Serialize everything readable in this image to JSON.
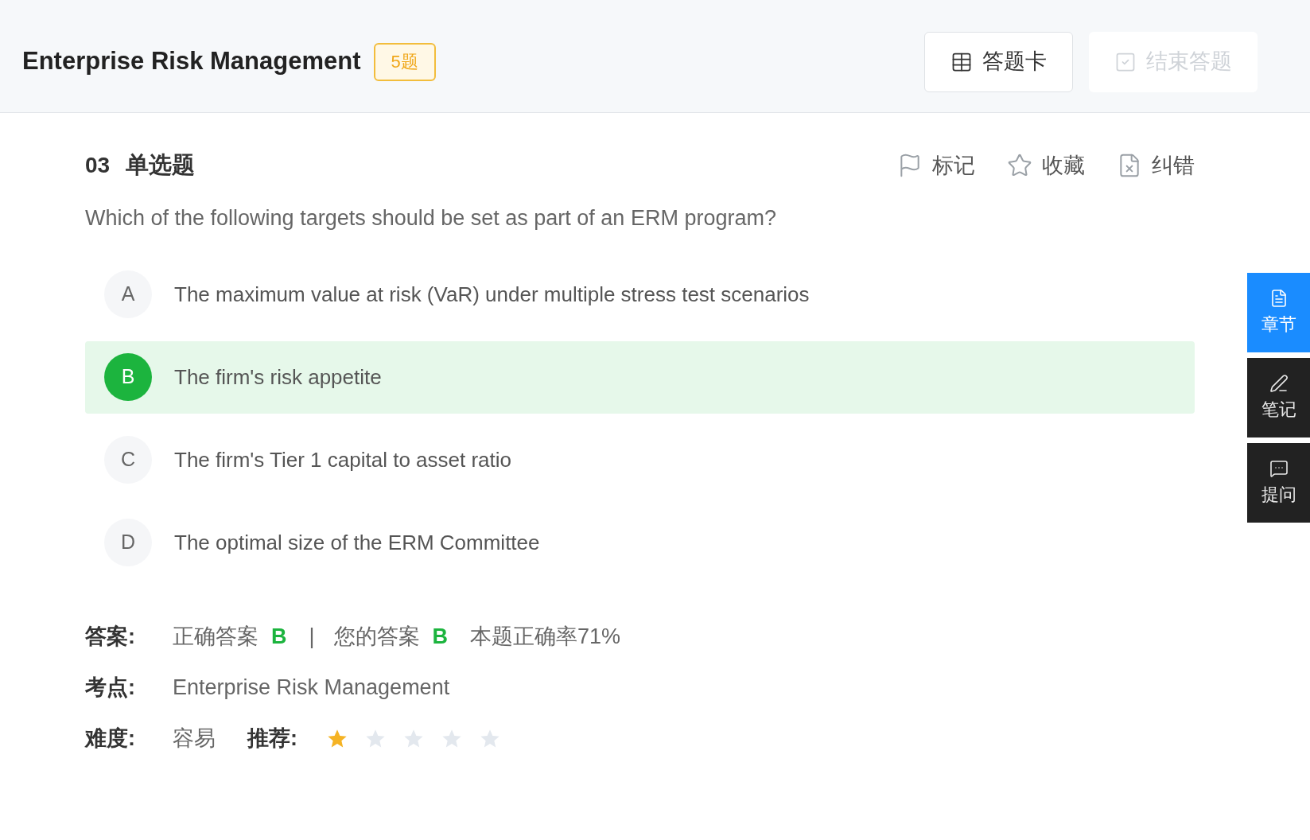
{
  "header": {
    "title": "Enterprise Risk Management",
    "count_badge": "5题",
    "buttons": [
      {
        "label": "答题卡",
        "kind": "card",
        "disabled": false
      },
      {
        "label": "结束答题",
        "kind": "finish",
        "disabled": true
      }
    ]
  },
  "question": {
    "number": "03",
    "type": "单选题",
    "actions": [
      {
        "label": "标记",
        "kind": "flag"
      },
      {
        "label": "收藏",
        "kind": "star"
      },
      {
        "label": "纠错",
        "kind": "report"
      }
    ],
    "text": "Which of the following targets should be set as part of an ERM program?",
    "options": [
      {
        "letter": "A",
        "text": "The maximum value at risk (VaR) under multiple stress test scenarios",
        "selected": false
      },
      {
        "letter": "B",
        "text": "The firm's risk appetite",
        "selected": true
      },
      {
        "letter": "C",
        "text": "The firm's Tier 1 capital to asset ratio",
        "selected": false
      },
      {
        "letter": "D",
        "text": "The optimal size of the ERM Committee",
        "selected": false
      }
    ]
  },
  "answer": {
    "label": "答案:",
    "correct_label": "正确答案",
    "correct": "B",
    "separator": "|",
    "yours_label": "您的答案",
    "yours": "B",
    "rate": "本题正确率71%"
  },
  "topic": {
    "label": "考点:",
    "value": "Enterprise Risk Management"
  },
  "difficulty": {
    "label": "难度:",
    "value": "容易",
    "recommend_label": "推荐:",
    "stars": 1
  },
  "side_tabs": [
    {
      "label": "章节",
      "kind": "chapter",
      "selected": true
    },
    {
      "label": "笔记",
      "kind": "note",
      "selected": false
    },
    {
      "label": "提问",
      "kind": "ask",
      "selected": false
    }
  ]
}
